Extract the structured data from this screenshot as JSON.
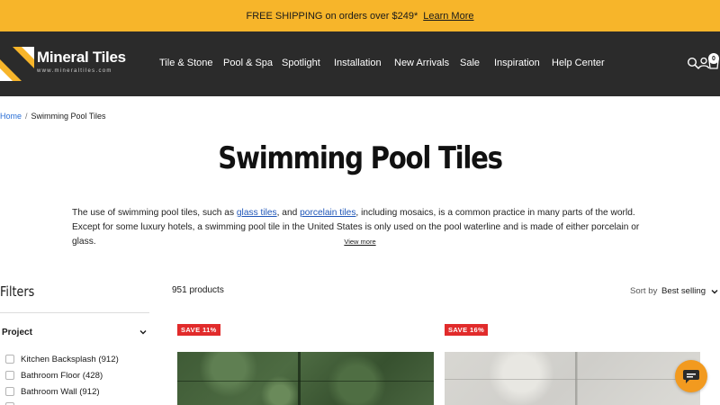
{
  "announcement": {
    "text": "FREE SHIPPING on orders over $249*",
    "link": "Learn More"
  },
  "brand": {
    "name": "Mineral Tiles",
    "url": "www.mineraltiles.com"
  },
  "nav": [
    "Tile & Stone",
    "Pool & Spa",
    "Spotlight",
    "Installation",
    "New Arrivals",
    "Sale",
    "Inspiration",
    "Help Center"
  ],
  "header_icons": [
    "search-icon",
    "account-icon",
    "cart-icon"
  ],
  "cart_count": "0",
  "breadcrumb": {
    "home": "Home",
    "separator": "/",
    "current": "Swimming Pool Tiles"
  },
  "page_title": "Swimming Pool Tiles",
  "description": {
    "p1": "The use of swimming pool tiles, such as ",
    "link1": "glass tiles",
    "p2": ", and ",
    "link2": "porcelain tiles",
    "p3": ", including mosaics, is a common practice in many parts of the world. Except for some luxury hotels, a swimming pool tile in the United States is only used on the pool waterline and is made of either porcelain or glass."
  },
  "view_more": "View more",
  "filters": {
    "title": "Filters",
    "project": {
      "label": "Project",
      "options": [
        {
          "label": "Kitchen Backsplash (912)"
        },
        {
          "label": "Bathroom Floor (428)"
        },
        {
          "label": "Bathroom Wall (912)"
        }
      ]
    }
  },
  "products_count": "951 products",
  "sort": {
    "label": "Sort by",
    "value": "Best selling"
  },
  "products": [
    {
      "badge": "SAVE 11%"
    },
    {
      "badge": "SAVE 16%"
    }
  ],
  "colors": {
    "announce_bg": "#f7b52a",
    "header_bg": "#2b2b2b",
    "sale_badge": "#e12b2b",
    "chat_button": "#f29a1f",
    "link": "#1f56b8"
  }
}
